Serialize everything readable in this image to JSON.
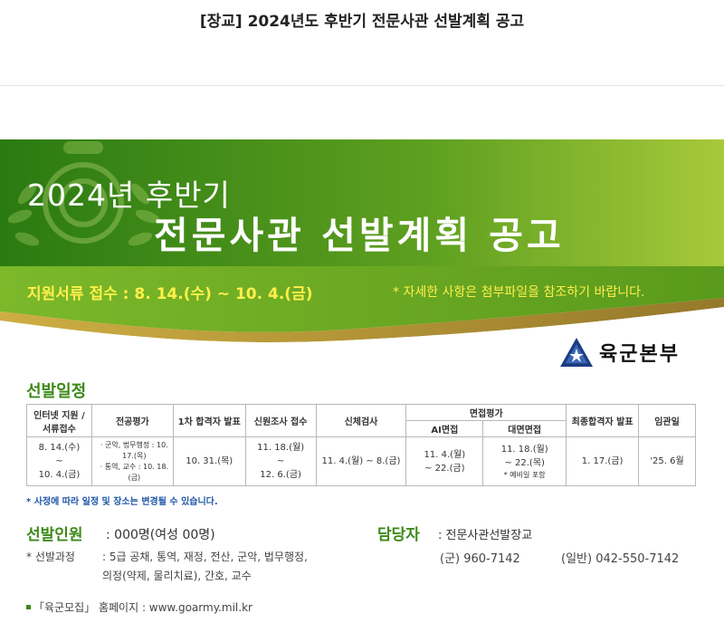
{
  "page": {
    "title": "[장교] 2024년도 후반기 전문사관 선발계획 공고"
  },
  "banner": {
    "line1": "2024년 후반기",
    "line2": "전문사관 선발계획 공고",
    "period_label": "지원서류 접수 : 8. 14.(수) ~ 10. 4.(금)",
    "note": "* 자세한 사항은 첨부파일을 참조하기 바랍니다.",
    "colors": {
      "green_top": "#1f6f10",
      "green_bottom": "#8cc230",
      "text_yellow": "#fff04a"
    }
  },
  "logo": {
    "text": "육군본부"
  },
  "schedule": {
    "title": "선발일정",
    "headers": {
      "apply": "인터넷 지원 / 서류접수",
      "major": "전공평가",
      "first_pass": "1차 합격자 발표",
      "background": "신원조사 접수",
      "physical": "신체검사",
      "interview": "면접평가",
      "ai_interview": "AI면접",
      "face_interview": "대면면접",
      "final_pass": "최종합격자 발표",
      "commission": "임관일"
    },
    "row": {
      "apply_start": "8. 14.(수)",
      "apply_tilde": "~",
      "apply_end": "10. 4.(금)",
      "major_1": "· 군악, 법무행정 : 10. 17.(목)",
      "major_2": "· 통역, 교수 : 10. 18.(금)",
      "first_pass": "10. 31.(목)",
      "background_start": "11. 18.(월)",
      "background_tilde": "~",
      "background_end": "12. 6.(금)",
      "physical": "11. 4.(월) ~ 8.(금)",
      "ai_start": "11. 4.(월)",
      "ai_end": "~ 22.(금)",
      "face_start": "11. 18.(월)",
      "face_end": "~ 22.(목)",
      "face_note": "* 예비일 포함",
      "final_pass": "1. 17.(금)",
      "commission": "'25. 6월"
    },
    "footnote": "* 사정에 따라 일정 및 장소는 변경될 수 있습니다."
  },
  "selection": {
    "label": "선발인원",
    "value": ": 000명(여성 00명)",
    "course_label": "* 선발과정",
    "course_line1": ": 5급 공채, 통역, 재정, 전산, 군악, 법무행정,",
    "course_line2": "의정(약제, 물리치료), 간호, 교수"
  },
  "contact": {
    "label": "담당자",
    "value": ": 전문사관선발장교",
    "tel_military": "(군) 960-7142",
    "tel_general": "(일반) 042-550-7142"
  },
  "homepage": {
    "text": "「육군모집」 홈페이지 : www.goarmy.mil.kr"
  }
}
